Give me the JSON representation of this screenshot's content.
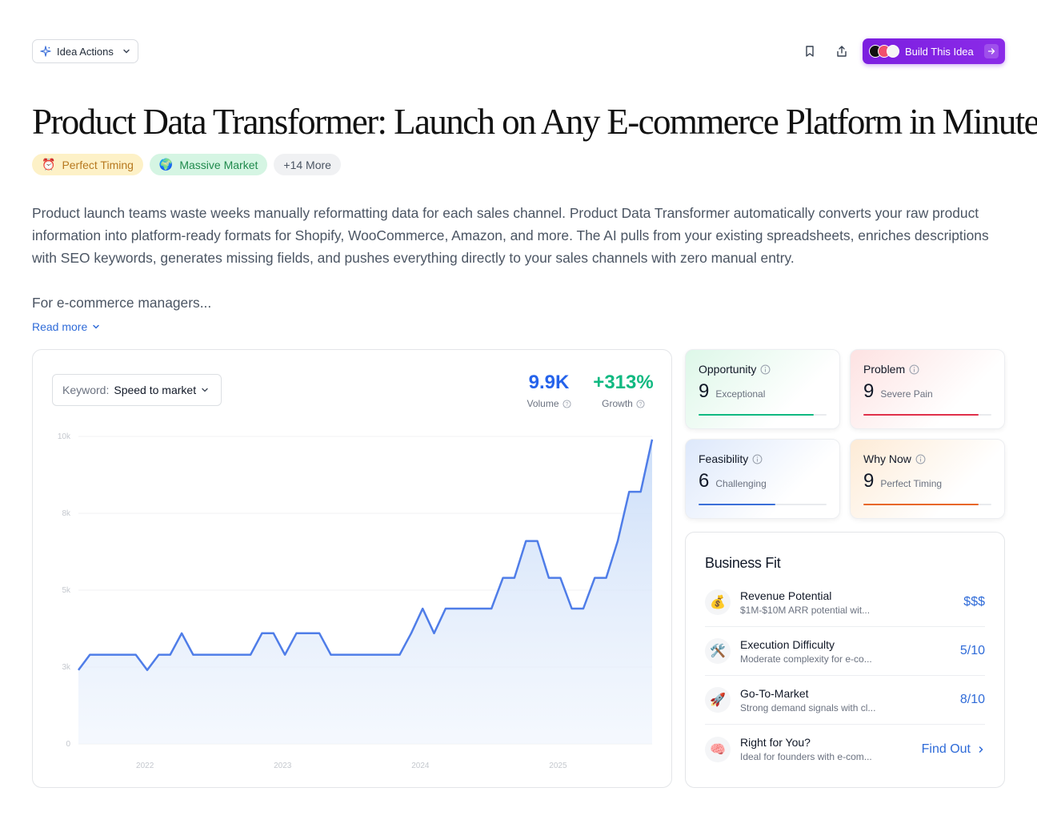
{
  "toolbar": {
    "idea_actions_label": "Idea Actions",
    "build_label": "Build This Idea"
  },
  "title": "Product Data Transformer: Launch on Any E-commerce Platform in Minutes",
  "tags": [
    {
      "emoji": "⏰",
      "label": "Perfect Timing"
    },
    {
      "emoji": "🌍",
      "label": "Massive Market"
    },
    {
      "label": "+14 More"
    }
  ],
  "description": {
    "paragraph1": "Product launch teams waste weeks manually reformatting data for each sales channel. Product Data Transformer automatically converts your raw product information into platform-ready formats for Shopify, WooCommerce, Amazon, and more. The AI pulls from your existing spreadsheets, enriches descriptions with SEO keywords, generates missing fields, and pushes everything directly to your sales channels with zero manual entry.",
    "paragraph2": "For e-commerce managers...",
    "read_more": "Read more"
  },
  "keyword": {
    "label": "Keyword:",
    "value": "Speed to market"
  },
  "stats": {
    "volume_value": "9.9K",
    "volume_label": "Volume",
    "growth_value": "+313%",
    "growth_label": "Growth"
  },
  "chart_data": {
    "type": "area",
    "ytick_labels": [
      "0",
      "3k",
      "5k",
      "8k",
      "10k"
    ],
    "ylim": [
      0,
      10000
    ],
    "xtick_labels": [
      "2022",
      "2023",
      "2024",
      "2025"
    ],
    "x_index_of_xticks": [
      5.8,
      17.8,
      29.8,
      41.8
    ],
    "values": [
      2400,
      2900,
      2900,
      2900,
      2900,
      2900,
      2400,
      2900,
      2900,
      3600,
      2900,
      2900,
      2900,
      2900,
      2900,
      2900,
      3600,
      3600,
      2900,
      3600,
      3600,
      3600,
      2900,
      2900,
      2900,
      2900,
      2900,
      2900,
      2900,
      3600,
      4400,
      3600,
      4400,
      4400,
      4400,
      4400,
      4400,
      5400,
      5400,
      6600,
      6600,
      5400,
      5400,
      4400,
      4400,
      5400,
      5400,
      6600,
      8200,
      8200,
      9900
    ],
    "line_color": "#4f7de8",
    "fill_color": "#dbe8fb",
    "grid": true
  },
  "scores": {
    "opportunity": {
      "label": "Opportunity",
      "value": "9",
      "sub": "Exceptional",
      "fill": 0.9,
      "color": "#10b981"
    },
    "problem": {
      "label": "Problem",
      "value": "9",
      "sub": "Severe Pain",
      "fill": 0.9,
      "color": "#e0304a"
    },
    "feasibility": {
      "label": "Feasibility",
      "value": "6",
      "sub": "Challenging",
      "fill": 0.6,
      "color": "#3b6fd8"
    },
    "why_now": {
      "label": "Why Now",
      "value": "9",
      "sub": "Perfect Timing",
      "fill": 0.9,
      "color": "#e8672a"
    }
  },
  "business_fit": {
    "title": "Business Fit",
    "items": [
      {
        "emoji": "💰",
        "title": "Revenue Potential",
        "desc": "$1M-$10M ARR potential wit...",
        "value": "$$$"
      },
      {
        "emoji": "🛠️",
        "title": "Execution Difficulty",
        "desc": "Moderate complexity for e-co...",
        "value": "5/10"
      },
      {
        "emoji": "🚀",
        "title": "Go-To-Market",
        "desc": "Strong demand signals with cl...",
        "value": "8/10"
      },
      {
        "emoji": "🧠",
        "title": "Right for You?",
        "desc": "Ideal for founders with e-com...",
        "value": "Find Out"
      }
    ]
  }
}
